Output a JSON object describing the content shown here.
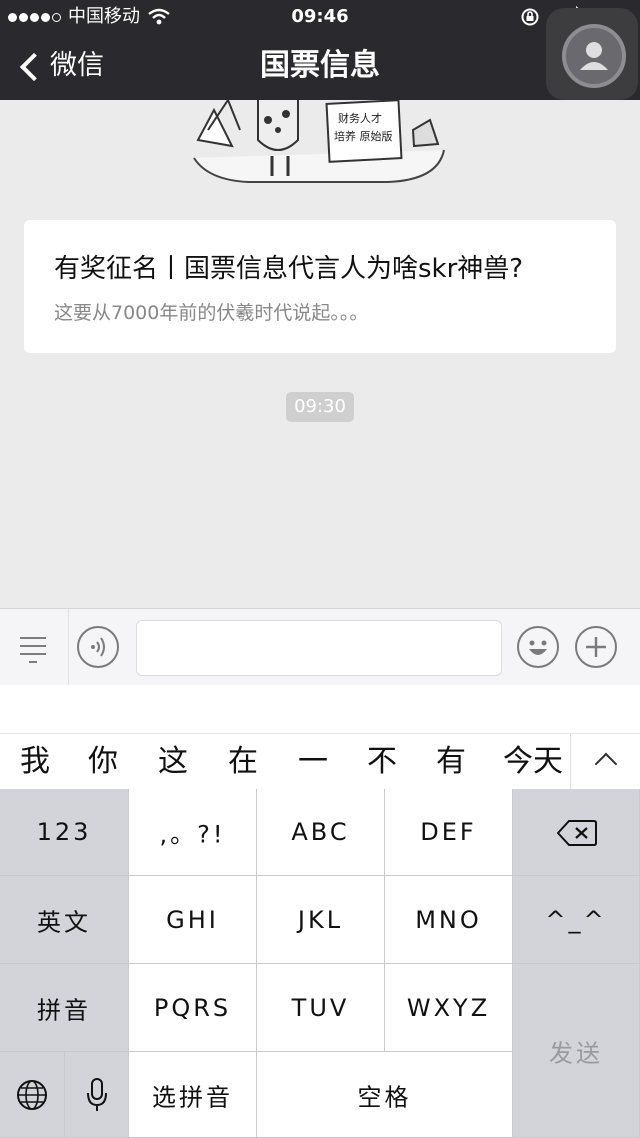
{
  "status_bar": {
    "carrier": "中国移动",
    "time": "09:46"
  },
  "nav": {
    "back_label": "微信",
    "title": "国票信息"
  },
  "message": {
    "title": "有奖征名丨国票信息代言人为啥skr神兽?",
    "description": "这要从7000年前的伏羲时代说起。。。",
    "timestamp": "09:30"
  },
  "illustration_text": {
    "line1": "财务人才",
    "line2": "培养 原始版"
  },
  "candidates": [
    "我",
    "你",
    "这",
    "在",
    "一",
    "不",
    "有",
    "今天"
  ],
  "keyboard": {
    "num": "123",
    "punct": ",。?!",
    "abc": "ABC",
    "def": "DEF",
    "english": "英文",
    "ghi": "GHI",
    "jkl": "JKL",
    "mno": "MNO",
    "emoticon": "^_^",
    "pinyin": "拼音",
    "pqrs": "PQRS",
    "tuv": "TUV",
    "wxyz": "WXYZ",
    "send": "发送",
    "select_pinyin": "选拼音",
    "space": "空格"
  },
  "colors": {
    "nav_bg": "#2a2a2e",
    "chat_bg": "#ebebeb",
    "key_dark": "#d2d4d9"
  }
}
